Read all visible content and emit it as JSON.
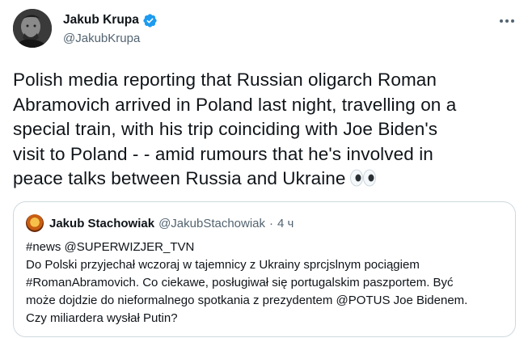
{
  "author": {
    "display_name": "Jakub Krupa",
    "handle": "@JakubKrupa",
    "verified": true
  },
  "tweet": {
    "text_lines": [
      "Polish media reporting that Russian oligarch Roman",
      "Abramovich arrived in Poland last night, travelling on a",
      "special train, with his trip coinciding with Joe Biden's",
      "visit to Poland - - amid rumours that he's involved in",
      "peace talks between Russia and Ukraine"
    ],
    "emoji": "eyes-emoji"
  },
  "quote": {
    "display_name": "Jakub Stachowiak",
    "handle": "@JakubStachowiak",
    "separator": "·",
    "time": "4 ч",
    "text_lines": [
      "#news @SUPERWIZJER_TVN",
      "Do Polski przyjechał wczoraj w tajemnicy z Ukrainy sprcjslnym pociągiem",
      "#RomanAbramovich. Co ciekawe, posługiwał się portugalskim paszportem. Być",
      "może dojdzie do nieformalnego spotkania z prezydentem @POTUS Joe Bidenem.",
      "Czy miliardera wysłał Putin?"
    ]
  },
  "icons": {
    "more": "more-horizontal-icon",
    "verified": "verified-badge-icon"
  },
  "colors": {
    "text": "#0f1419",
    "secondary": "#536471",
    "verified": "#1d9bf0",
    "border": "#cfd9de"
  }
}
